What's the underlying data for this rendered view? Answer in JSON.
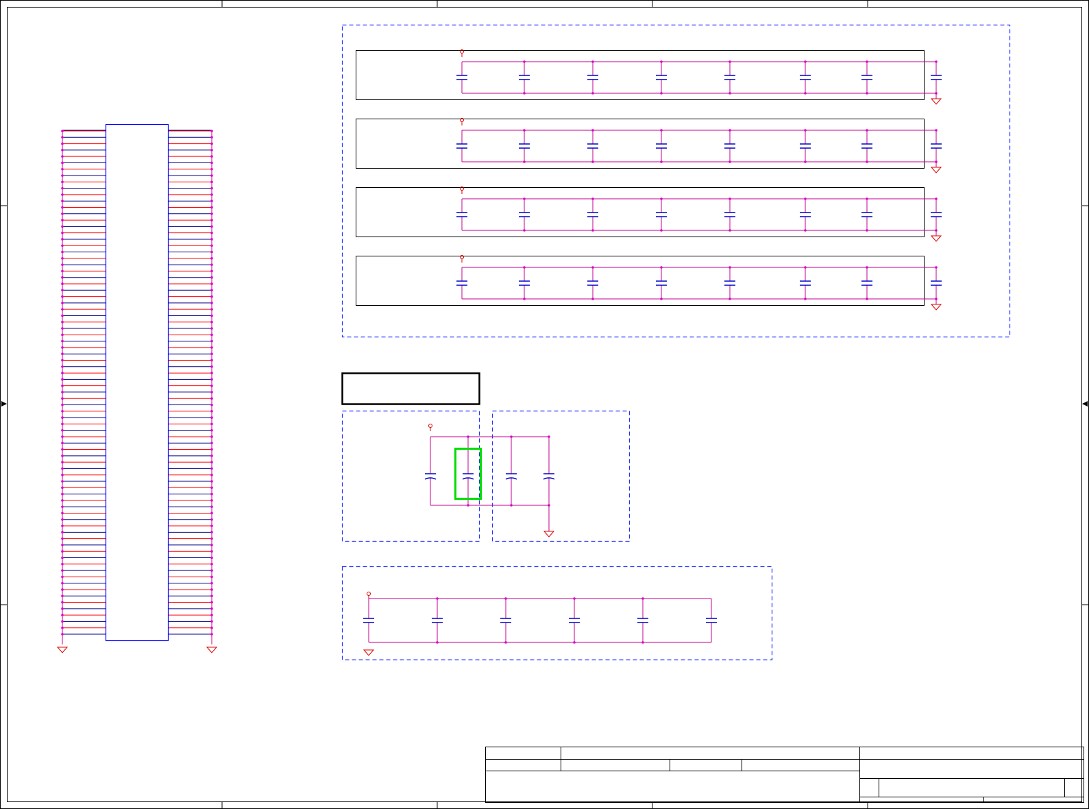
{
  "sheet": {
    "title_block": {
      "cells": [
        "",
        "",
        "",
        "",
        "",
        "",
        "",
        "",
        "",
        ""
      ]
    }
  },
  "colors": {
    "border": "#000000",
    "net_magenta": "#c0008c",
    "pin_red": "#ff0000",
    "pin_navy": "#000080",
    "part_blue": "#0000ff",
    "cap_blue": "#0000cc",
    "junction": "#e000d0",
    "power_red": "#dd0000",
    "highlight_green": "#00dd00"
  },
  "components": {
    "connector": {
      "pins_per_side": 80,
      "label": ""
    },
    "decoupling_banks": {
      "rows": 4,
      "caps_per_row": 8
    },
    "filter_group": {
      "caps": 4,
      "highlighted_index": 1
    },
    "bottom_bank": {
      "caps": 6
    }
  },
  "icons": [
    "power-port-icon",
    "ground-symbol-icon",
    "capacitor-icon",
    "arrow-marker-icon"
  ]
}
